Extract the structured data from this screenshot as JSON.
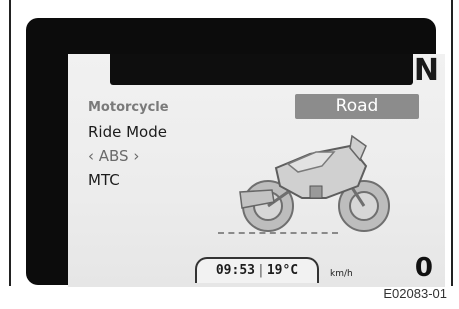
{
  "display": {
    "gear": "N",
    "menu": {
      "header": "Motorcycle",
      "items": [
        "Ride Mode",
        "‹ ABS ›",
        "MTC"
      ]
    },
    "mode_value": "Road",
    "clock": "09:53",
    "temperature": "19°C",
    "speed_unit": "km/h",
    "speed": "0"
  },
  "figure_code": "E02083-01"
}
